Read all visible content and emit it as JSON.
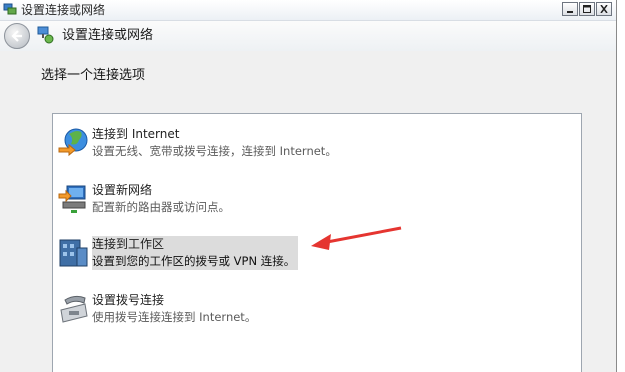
{
  "window": {
    "title": "设置连接或网络"
  },
  "nav": {
    "title": "设置连接或网络"
  },
  "content": {
    "heading": "选择一个连接选项"
  },
  "options": [
    {
      "title": "连接到 Internet",
      "desc": "设置无线、宽带或拨号连接，连接到 Internet。"
    },
    {
      "title": "设置新网络",
      "desc": "配置新的路由器或访问点。"
    },
    {
      "title": "连接到工作区",
      "desc": "设置到您的工作区的拨号或 VPN 连接。"
    },
    {
      "title": "设置拨号连接",
      "desc": "使用拨号连接连接到 Internet。"
    }
  ],
  "selected_option": 2,
  "colors": {
    "selection": "#dcdcdc",
    "annotation_arrow": "#e53530"
  }
}
